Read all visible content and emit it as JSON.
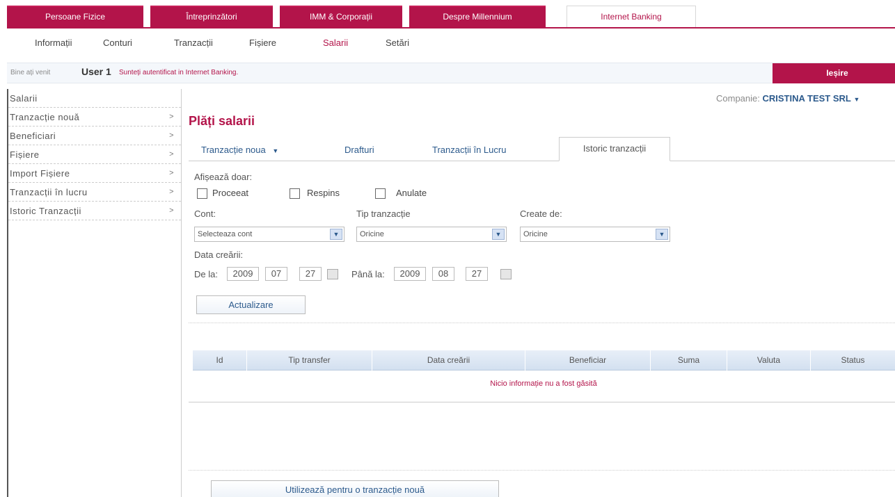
{
  "top_tabs": [
    "Persoane Fizice",
    "Întreprinzători",
    "IMM & Corporații",
    "Despre Millennium",
    "Internet Banking"
  ],
  "sub_menu": [
    "Informații",
    "Conturi",
    "Tranzacții",
    "Fișiere",
    "Salarii",
    "Setări"
  ],
  "welcome": {
    "greeting": "Bine ați venit",
    "user": "User 1",
    "status": "Sunteți autentificat in Internet Banking."
  },
  "logout_label": "Ieșire",
  "sidebar": [
    {
      "label": "Salarii"
    },
    {
      "label": "Tranzacție nouă",
      "arrow": ">"
    },
    {
      "label": "Beneficiari",
      "arrow": ">"
    },
    {
      "label": "Fișiere",
      "arrow": ">"
    },
    {
      "label": "Import Fișiere",
      "arrow": ">"
    },
    {
      "label": "Tranzacții în lucru",
      "arrow": ">"
    },
    {
      "label": "Istoric Tranzacții",
      "arrow": ">"
    }
  ],
  "company": {
    "label": "Companie:",
    "value": "CRISTINA TEST SRL"
  },
  "page_title": "Plăți salarii",
  "tabs": [
    "Tranzacție noua",
    "Drafturi",
    "Tranzacții în Lucru",
    "Istoric tranzacții"
  ],
  "filter": {
    "show_only": "Afișează doar:",
    "checkboxes": [
      "Proceeat",
      "Respins",
      "Anulate"
    ],
    "account_label": "Cont:",
    "account_value": "Selecteaza cont",
    "type_label": "Tip tranzacție",
    "type_value": "Oricine",
    "created_by_label": "Create de:",
    "created_by_value": "Oricine",
    "date_label": "Data creării:",
    "from_label": "De la:",
    "from": {
      "year": "2009",
      "month": "07",
      "day": "27"
    },
    "to_label": "Până la:",
    "to": {
      "year": "2009",
      "month": "08",
      "day": "27"
    },
    "update_button": "Actualizare"
  },
  "table": {
    "columns": [
      "Id",
      "Tip transfer",
      "Data creării",
      "Beneficiar",
      "Suma",
      "Valuta",
      "Status"
    ],
    "empty_message": "Nicio informație nu a fost găsită"
  },
  "bottom_button": "Utilizează pentru o tranzacție nouă",
  "colors": {
    "brand": "#b3144a",
    "link": "#2c5a8c"
  }
}
